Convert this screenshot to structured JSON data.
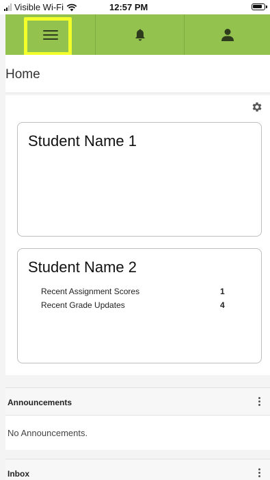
{
  "status_bar": {
    "carrier": "Visible Wi-Fi",
    "time": "12:57 PM"
  },
  "nav": {
    "items": [
      {
        "name": "menu",
        "icon": "hamburger-icon"
      },
      {
        "name": "notifications",
        "icon": "bell-icon"
      },
      {
        "name": "profile",
        "icon": "user-icon"
      }
    ],
    "background_color": "#93c24e",
    "highlight_color": "#f3ff2a"
  },
  "page": {
    "title": "Home"
  },
  "students": [
    {
      "name": "Student Name 1",
      "metrics": []
    },
    {
      "name": "Student Name 2",
      "metrics": [
        {
          "label": "Recent Assignment Scores",
          "value": "1"
        },
        {
          "label": "Recent Grade Updates",
          "value": "4"
        }
      ]
    }
  ],
  "announcements": {
    "title": "Announcements",
    "empty_text": "No Announcements."
  },
  "inbox": {
    "title": "Inbox"
  }
}
